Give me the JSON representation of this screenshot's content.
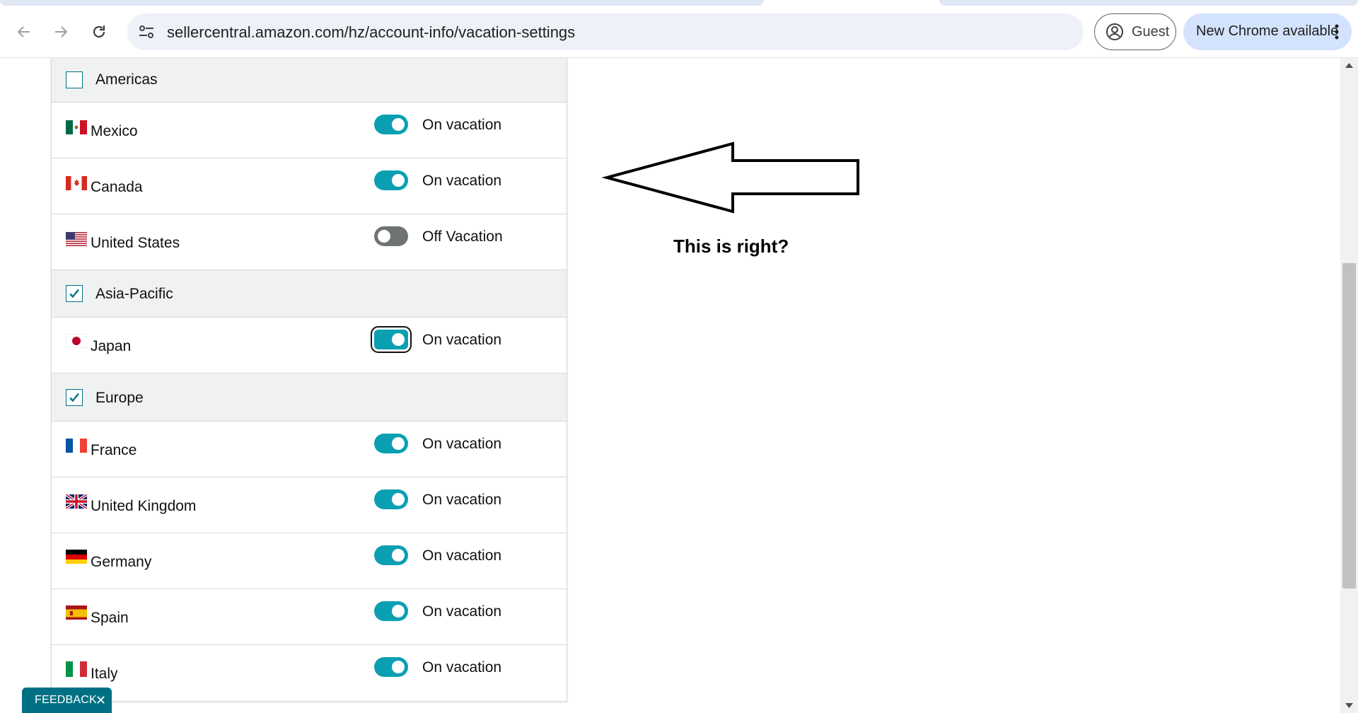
{
  "browser": {
    "url": "sellercentral.amazon.com/hz/account-info/vacation-settings",
    "profile_label": "Guest",
    "update_label": "New Chrome available"
  },
  "regions": [
    {
      "label": "Americas",
      "checked": false
    },
    {
      "label": "Asia-Pacific",
      "checked": true
    },
    {
      "label": "Europe",
      "checked": true
    }
  ],
  "countries": [
    {
      "name": "Mexico",
      "status": "On vacation",
      "on": true
    },
    {
      "name": "Canada",
      "status": "On vacation",
      "on": true
    },
    {
      "name": "United States",
      "status": "Off Vacation",
      "on": false
    },
    {
      "name": "Japan",
      "status": "On vacation",
      "on": true
    },
    {
      "name": "France",
      "status": "On vacation",
      "on": true
    },
    {
      "name": "United Kingdom",
      "status": "On vacation",
      "on": true
    },
    {
      "name": "Germany",
      "status": "On vacation",
      "on": true
    },
    {
      "name": "Spain",
      "status": "On vacation",
      "on": true
    },
    {
      "name": "Italy",
      "status": "On vacation",
      "on": true
    }
  ],
  "annotation": {
    "text": "This is right?"
  },
  "feedback": {
    "label": "FEEDBACK",
    "close": "✕"
  },
  "colors": {
    "toggle_on": "#0b9fb2",
    "toggle_off": "#6f7373",
    "accent": "#007185"
  }
}
